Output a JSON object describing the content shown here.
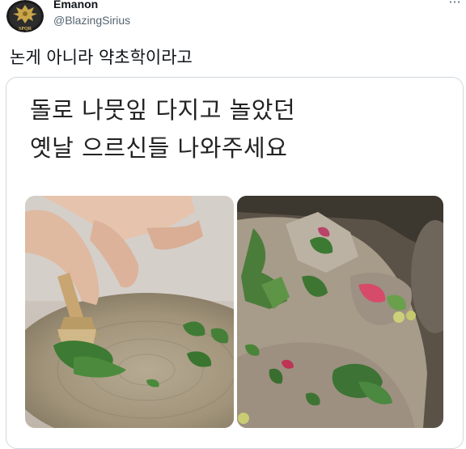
{
  "author": {
    "display_name": "Emanon",
    "handle": "@BlazingSirius",
    "avatar_text": "SPQR"
  },
  "more_icon": "more-horizontal-icon",
  "tweet": {
    "text": "논게 아니라 약초학이라고"
  },
  "media": {
    "caption_line1": "돌로 나뭇잎 다지고 놀았던",
    "caption_line2": "옛날 으르신들 나와주세요"
  }
}
